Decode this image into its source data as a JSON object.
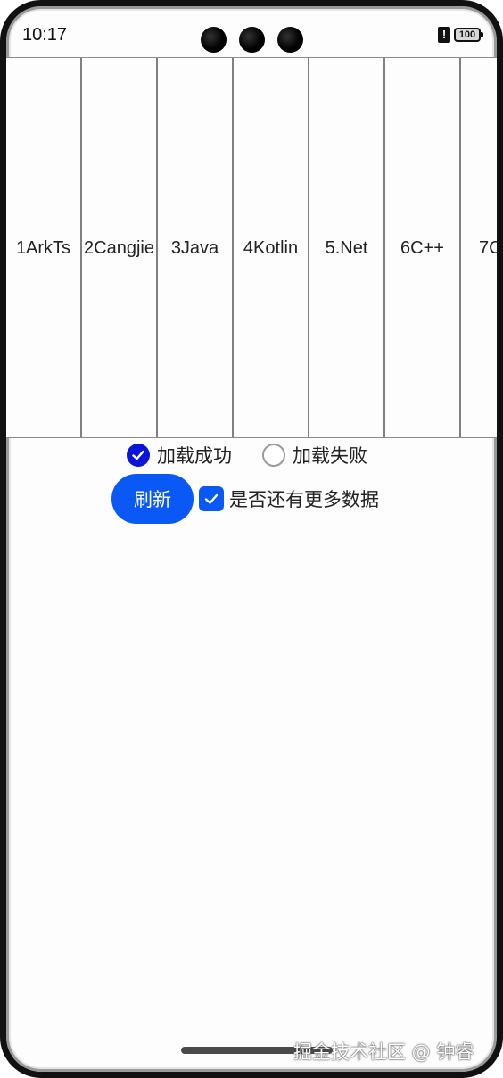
{
  "statusbar": {
    "time": "10:17",
    "alert_icon": "!",
    "battery_level": "100"
  },
  "grid": {
    "cells": [
      "1ArkTs",
      "2Cangjie",
      "3Java",
      "4Kotlin",
      "5.Net",
      "6C++",
      "7C"
    ]
  },
  "radio_group": {
    "options": [
      {
        "label": "加载成功",
        "checked": true
      },
      {
        "label": "加载失败",
        "checked": false
      }
    ]
  },
  "actions": {
    "refresh_label": "刷新",
    "has_more_label": "是否还有更多数据",
    "has_more_checked": true
  },
  "watermark": "掘金技术社区 @ 钟睿",
  "colors": {
    "accent": "#0a59f7",
    "radio_checked": "#0a14d8",
    "cell_border": "#808080"
  }
}
